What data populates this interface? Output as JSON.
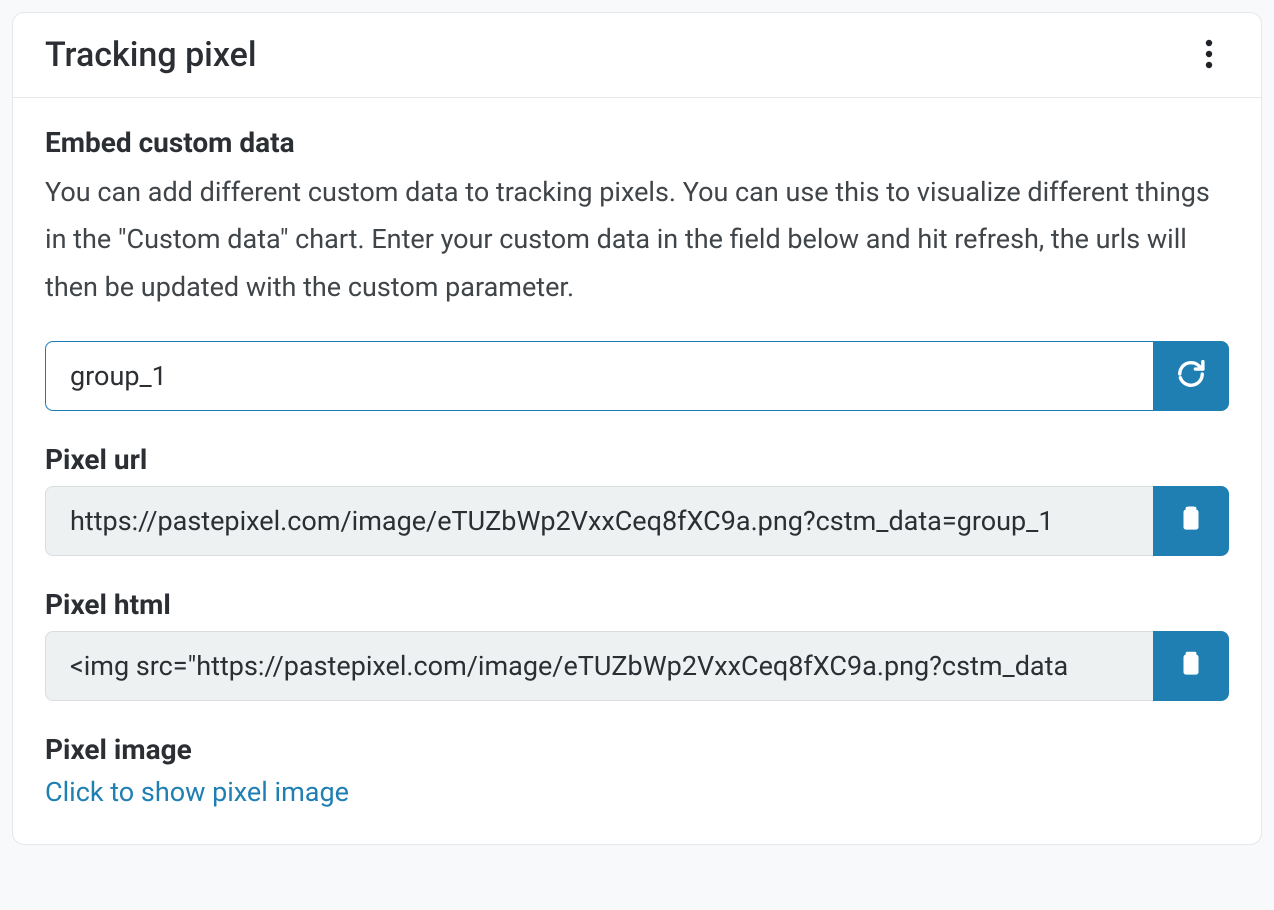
{
  "card": {
    "title": "Tracking pixel"
  },
  "embed": {
    "heading": "Embed custom data",
    "description": "You can add different custom data to tracking pixels. You can use this to visualize different things in the \"Custom data\" chart. Enter your custom data in the field below and hit refresh, the urls will then be updated with the custom parameter.",
    "input_value": "group_1"
  },
  "pixel_url": {
    "label": "Pixel url",
    "value": "https://pastepixel.com/image/eTUZbWp2VxxCeq8fXC9a.png?cstm_data=group_1"
  },
  "pixel_html": {
    "label": "Pixel html",
    "value": "<img src=\"https://pastepixel.com/image/eTUZbWp2VxxCeq8fXC9a.png?cstm_data"
  },
  "pixel_image": {
    "label": "Pixel image",
    "link_text": "Click to show pixel image"
  },
  "icons": {
    "menu": "more-vertical",
    "refresh": "refresh",
    "clipboard": "clipboard"
  },
  "colors": {
    "accent": "#1f7fb3",
    "text": "#2b2f33",
    "muted_bg": "#eef1f2",
    "border": "#e5e7eb"
  }
}
